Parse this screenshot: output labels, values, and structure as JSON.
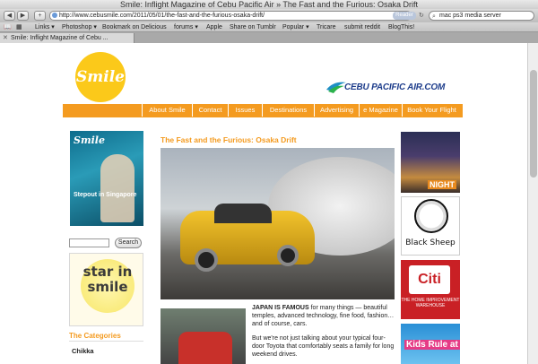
{
  "window": {
    "title": "Smile: Inflight Magazine of Cebu Pacific Air » The Fast and the Furious: Osaka Drift"
  },
  "toolbar": {
    "back": "◀",
    "forward": "▶",
    "add": "+",
    "url": "http://www.cebusmile.com/2011/05/01/the-fast-and-the-furious-osaka-drift/",
    "reader": "Reader",
    "reload": "↻",
    "search_value": "mac ps3 media server"
  },
  "bookmarks": {
    "items": [
      "Links ▾",
      "Photoshop ▾",
      "Bookmark on Delicious",
      "forums ▾",
      "Apple",
      "Share on Tumblr",
      "Popular ▾",
      "Tricare",
      "submit reddit",
      "BlogThis!"
    ]
  },
  "tab": {
    "label": "Smile: Inflight Magazine of Cebu ...",
    "close": "✕"
  },
  "site": {
    "logo": "Smile",
    "partner": "CEBU PACIFIC AIR.COM",
    "nav": [
      "About Smile",
      "Contact",
      "Issues",
      "Destinations",
      "Advertising",
      "e Magazine",
      "Book Your Flight"
    ]
  },
  "sidebar_left": {
    "cover_title": "Smile",
    "cover_story": "Stepout in Singapore",
    "search_button": "Search",
    "star_text": "star in smile",
    "categories_heading": "The Categories",
    "categories": [
      "Chikka"
    ]
  },
  "article": {
    "title": "The Fast and the Furious: Osaka Drift",
    "lead_bold": "JAPAN IS FAMOUS",
    "lead_rest": " for many things — beautiful temples, advanced technology, fine food, fashion… and of course, cars.",
    "para2": "But we're not just talking about your typical four-door Toyota that comfortably seats a family for long weekend drives."
  },
  "ads": {
    "ad1": "NIGHT",
    "ad2": "Black Sheep",
    "ad3_logo": "Citi",
    "ad3_sub": "THE HOME IMPROVEMENT WAREHOUSE",
    "ad4": "Kids Rule at"
  },
  "colors": {
    "accent": "#f49b20",
    "logo_yellow": "#fbc91a",
    "partner_blue": "#1f3e8c"
  }
}
